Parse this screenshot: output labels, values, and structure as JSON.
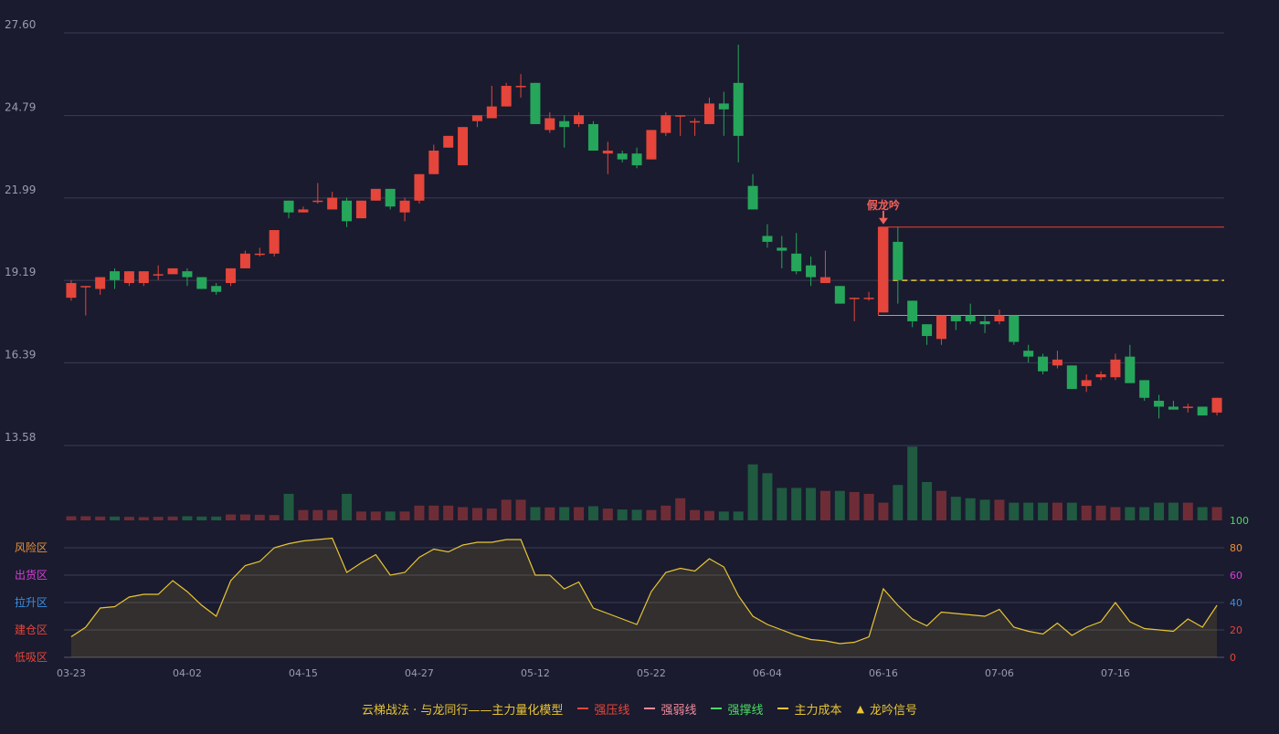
{
  "chart_data": {
    "type": "candlestick",
    "price_ticks": [
      "27.60",
      "24.79",
      "21.99",
      "19.19",
      "16.39",
      "13.58"
    ],
    "ylim": [
      13.58,
      27.6
    ],
    "x_tick_labels": [
      "03-23",
      "04-02",
      "04-15",
      "04-27",
      "05-12",
      "05-22",
      "06-04",
      "06-16",
      "07-06",
      "07-16"
    ],
    "x_tick_index": [
      0,
      8,
      16,
      24,
      32,
      40,
      48,
      56,
      64,
      72
    ],
    "candles": [
      [
        18.6,
        19.1,
        19.2,
        18.5
      ],
      [
        19.0,
        19.0,
        19.0,
        18.0
      ],
      [
        18.9,
        19.3,
        19.3,
        18.7
      ],
      [
        19.5,
        19.2,
        19.6,
        18.9
      ],
      [
        19.1,
        19.5,
        19.5,
        19.0
      ],
      [
        19.1,
        19.5,
        19.5,
        19.0
      ],
      [
        19.4,
        19.4,
        19.7,
        19.2
      ],
      [
        19.4,
        19.6,
        19.6,
        19.4
      ],
      [
        19.5,
        19.3,
        19.6,
        19.0
      ],
      [
        19.3,
        18.9,
        19.3,
        18.9
      ],
      [
        19.0,
        18.8,
        19.1,
        18.7
      ],
      [
        19.1,
        19.6,
        19.6,
        19.0
      ],
      [
        19.6,
        20.1,
        20.2,
        19.6
      ],
      [
        20.1,
        20.1,
        20.3,
        20.0
      ],
      [
        20.1,
        20.9,
        20.9,
        20.0
      ],
      [
        21.9,
        21.5,
        21.9,
        21.3
      ],
      [
        21.5,
        21.6,
        21.7,
        21.5
      ],
      [
        21.9,
        21.9,
        22.5,
        21.8
      ],
      [
        21.6,
        22.0,
        22.2,
        21.6
      ],
      [
        21.9,
        21.2,
        22.0,
        21.0
      ],
      [
        21.3,
        21.9,
        21.9,
        21.3
      ],
      [
        21.9,
        22.3,
        22.3,
        21.9
      ],
      [
        22.3,
        21.7,
        22.3,
        21.6
      ],
      [
        21.5,
        21.9,
        22.0,
        21.2
      ],
      [
        21.9,
        22.8,
        22.8,
        21.8
      ],
      [
        22.8,
        23.6,
        23.8,
        22.8
      ],
      [
        23.7,
        24.1,
        24.1,
        23.7
      ],
      [
        23.1,
        24.4,
        24.4,
        23.1
      ],
      [
        24.6,
        24.8,
        24.8,
        24.4
      ],
      [
        24.7,
        25.1,
        25.8,
        24.7
      ],
      [
        25.1,
        25.8,
        25.9,
        25.1
      ],
      [
        25.8,
        25.8,
        26.2,
        25.4
      ],
      [
        25.9,
        24.5,
        25.9,
        24.5
      ],
      [
        24.3,
        24.7,
        24.9,
        24.2
      ],
      [
        24.6,
        24.4,
        24.8,
        23.7
      ],
      [
        24.5,
        24.8,
        24.9,
        24.4
      ],
      [
        24.5,
        23.6,
        24.6,
        23.6
      ],
      [
        23.5,
        23.6,
        23.9,
        22.8
      ],
      [
        23.5,
        23.3,
        23.6,
        23.2
      ],
      [
        23.5,
        23.1,
        23.7,
        23.0
      ],
      [
        23.3,
        24.3,
        24.3,
        23.3
      ],
      [
        24.2,
        24.8,
        24.9,
        24.1
      ],
      [
        24.8,
        24.8,
        24.8,
        24.1
      ],
      [
        24.6,
        24.6,
        24.7,
        24.1
      ],
      [
        24.5,
        25.2,
        25.4,
        24.5
      ],
      [
        25.2,
        25.0,
        25.6,
        24.1
      ],
      [
        25.9,
        24.1,
        27.2,
        23.2
      ],
      [
        22.4,
        21.6,
        22.8,
        21.6
      ],
      [
        20.7,
        20.5,
        21.1,
        20.3
      ],
      [
        20.3,
        20.2,
        20.7,
        19.6
      ],
      [
        20.1,
        19.5,
        20.8,
        19.4
      ],
      [
        19.7,
        19.3,
        20.0,
        19.0
      ],
      [
        19.1,
        19.3,
        20.2,
        19.1
      ],
      [
        19.0,
        18.4,
        19.0,
        18.4
      ],
      [
        18.6,
        18.6,
        18.6,
        17.8
      ],
      [
        18.6,
        18.6,
        18.8,
        18.5
      ],
      [
        18.1,
        21.0,
        21.0,
        18.1
      ],
      [
        20.5,
        19.2,
        21.0,
        18.4
      ],
      [
        18.5,
        17.8,
        18.5,
        17.6
      ],
      [
        17.7,
        17.3,
        17.7,
        17.0
      ],
      [
        17.2,
        18.0,
        18.0,
        17.0
      ],
      [
        18.0,
        17.8,
        18.0,
        17.5
      ],
      [
        18.0,
        17.8,
        18.4,
        17.7
      ],
      [
        17.8,
        17.7,
        18.0,
        17.4
      ],
      [
        17.8,
        18.0,
        18.2,
        17.7
      ],
      [
        18.0,
        17.1,
        18.0,
        17.0
      ],
      [
        16.8,
        16.6,
        17.0,
        16.4
      ],
      [
        16.6,
        16.1,
        16.7,
        16.0
      ],
      [
        16.3,
        16.5,
        16.8,
        16.2
      ],
      [
        16.3,
        15.5,
        16.3,
        15.5
      ],
      [
        15.6,
        15.8,
        16.0,
        15.4
      ],
      [
        15.9,
        16.0,
        16.1,
        15.8
      ],
      [
        15.9,
        16.5,
        16.7,
        15.8
      ],
      [
        16.6,
        15.7,
        17.0,
        15.7
      ],
      [
        15.8,
        15.2,
        15.8,
        15.1
      ],
      [
        15.1,
        14.9,
        15.3,
        14.5
      ],
      [
        14.9,
        14.8,
        15.1,
        14.8
      ],
      [
        14.9,
        14.9,
        15.0,
        14.7
      ],
      [
        14.9,
        14.6,
        14.9,
        14.6
      ],
      [
        14.7,
        15.2,
        15.2,
        14.6
      ]
    ],
    "volume": [
      14,
      14,
      13,
      13,
      12,
      11,
      12,
      13,
      14,
      13,
      13,
      20,
      20,
      19,
      18,
      90,
      35,
      35,
      35,
      90,
      30,
      30,
      30,
      30,
      50,
      50,
      50,
      45,
      42,
      40,
      70,
      70,
      45,
      44,
      45,
      45,
      48,
      40,
      37,
      36,
      35,
      50,
      75,
      35,
      32,
      30,
      30,
      190,
      160,
      110,
      110,
      110,
      100,
      100,
      96,
      90,
      60,
      120,
      250,
      130,
      100,
      80,
      75,
      70,
      70,
      60,
      60,
      60,
      60,
      60,
      50,
      50,
      45,
      45,
      45,
      60,
      60,
      60,
      45,
      45
    ],
    "volume_ylim": [
      0,
      260
    ],
    "oscillator": [
      15,
      22,
      36,
      37,
      44,
      46,
      46,
      56,
      48,
      38,
      30,
      56,
      67,
      70,
      80,
      83,
      85,
      86,
      87,
      62,
      69,
      75,
      60,
      62,
      73,
      79,
      77,
      82,
      84,
      84,
      86,
      86,
      60,
      60,
      50,
      55,
      36,
      32,
      28,
      24,
      48,
      62,
      65,
      63,
      72,
      66,
      45,
      30,
      24,
      20,
      16,
      13,
      12,
      10,
      11,
      15,
      50,
      38,
      28,
      23,
      33,
      32,
      31,
      30,
      35,
      22,
      19,
      17,
      25,
      16,
      22,
      26,
      40,
      26,
      21,
      20,
      19,
      28,
      22,
      38
    ],
    "oscillator_ticks": [
      "0",
      "20",
      "40",
      "60",
      "80",
      "100"
    ],
    "oscillator_ylim": [
      0,
      100
    ],
    "zone_labels": [
      "风险区",
      "出货区",
      "拉升区",
      "建仓区",
      "低吸区"
    ],
    "signal": {
      "label": "假龙吟",
      "index": 56,
      "price": 21.0
    },
    "levels": [
      {
        "name": "强压线",
        "value": 21.0,
        "start_index": 56,
        "color": "#e5453a",
        "style": "solid"
      },
      {
        "name": "主力成本",
        "value": 19.19,
        "start_index": 57,
        "color": "#e8c534",
        "style": "dash"
      },
      {
        "name": "强撑线",
        "value": 18.0,
        "start_index": 56,
        "color": "#4cd964",
        "style": "solid"
      }
    ],
    "legend": [
      {
        "label": "云梯战法 · 与龙同行——主力量化模型",
        "color": "#e8c534",
        "marker": "none"
      },
      {
        "label": "强压线",
        "color": "#e5453a",
        "marker": "line"
      },
      {
        "label": "强弱线",
        "color": "#f08a9c",
        "marker": "dash"
      },
      {
        "label": "强撑线",
        "color": "#4cd964",
        "marker": "line"
      },
      {
        "label": "主力成本",
        "color": "#e8c534",
        "marker": "dash"
      },
      {
        "label": "龙吟信号",
        "color": "#e8c534",
        "marker": "triangle"
      }
    ],
    "colors": {
      "up": "#e5453a",
      "down": "#26a65b",
      "up_volume": "#6e2d36",
      "down_volume": "#1f5a41",
      "oscillator_line": "#e8c534",
      "zone_colors": [
        "#e8913a",
        "#d63fd6",
        "#3d8fe0",
        "#e5453a",
        "#e5453a"
      ],
      "right_axis": [
        "#e5453a",
        "#e5453a",
        "#3d8fe0",
        "#d63fd6",
        "#e8913a",
        "#4cd964"
      ]
    }
  }
}
